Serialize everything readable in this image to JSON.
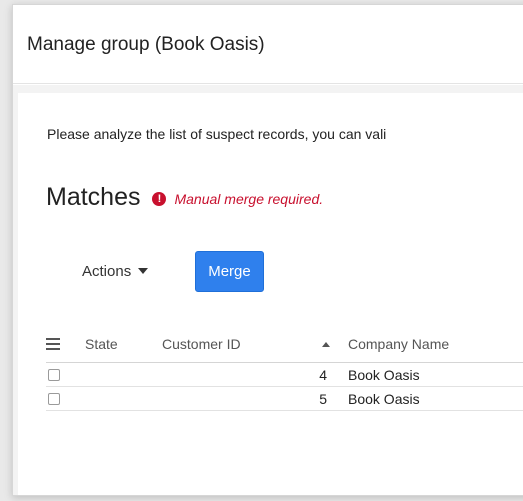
{
  "dialog": {
    "title": "Manage group (Book Oasis)"
  },
  "body": {
    "instructions": "Please analyze the list of suspect records, you can vali",
    "section_title": "Matches",
    "alert_text": "Manual merge required."
  },
  "toolbar": {
    "actions_label": "Actions",
    "merge_label": "Merge"
  },
  "table": {
    "columns": {
      "state": "State",
      "customer_id": "Customer ID",
      "company_name": "Company Name"
    },
    "rows": [
      {
        "customer_id": "4",
        "company_name": "Book Oasis"
      },
      {
        "customer_id": "5",
        "company_name": "Book Oasis"
      }
    ]
  },
  "icons": {
    "alert": "exclamation-circle-icon",
    "actions_dropdown": "caret-down-icon",
    "column_menu": "hamburger-menu-icon",
    "sort": "sort-ascending-icon"
  },
  "colors": {
    "accent": "#2f80ed",
    "error": "#c8102e"
  }
}
